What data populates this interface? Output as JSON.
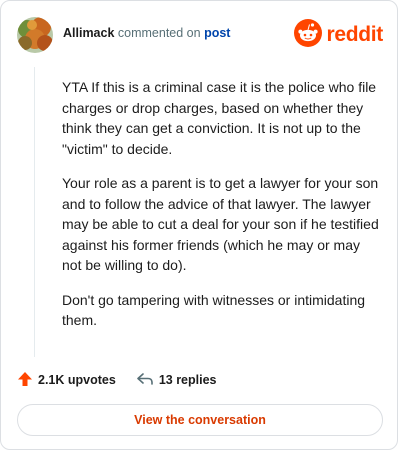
{
  "header": {
    "username": "Allimack",
    "action_text": "commented on",
    "post_link": "post",
    "brand": "reddit"
  },
  "comment": {
    "paragraphs": [
      "YTA If this is a criminal case it is the police who file charges or drop charges, based on whether they think they can get a conviction. It is not up to the \"victim\" to decide.",
      "Your role as a parent is to get a lawyer for your son and to follow the advice of that lawyer. The lawyer may be able to cut a deal for your son if he testified against his former friends (which he may or may not be willing to do).",
      "Don't go tampering with witnesses or intimidating them."
    ]
  },
  "footer": {
    "upvotes": "2.1K upvotes",
    "replies": "13 replies",
    "view_button": "View the conversation"
  },
  "icons": {
    "upvote": "upvote-arrow-icon",
    "reply": "reply-arrow-icon",
    "logo": "reddit-snoo-icon"
  },
  "colors": {
    "brand": "#ff4500",
    "link": "#0045ac",
    "button_text": "#d93a00",
    "border": "#dcdfe3"
  }
}
